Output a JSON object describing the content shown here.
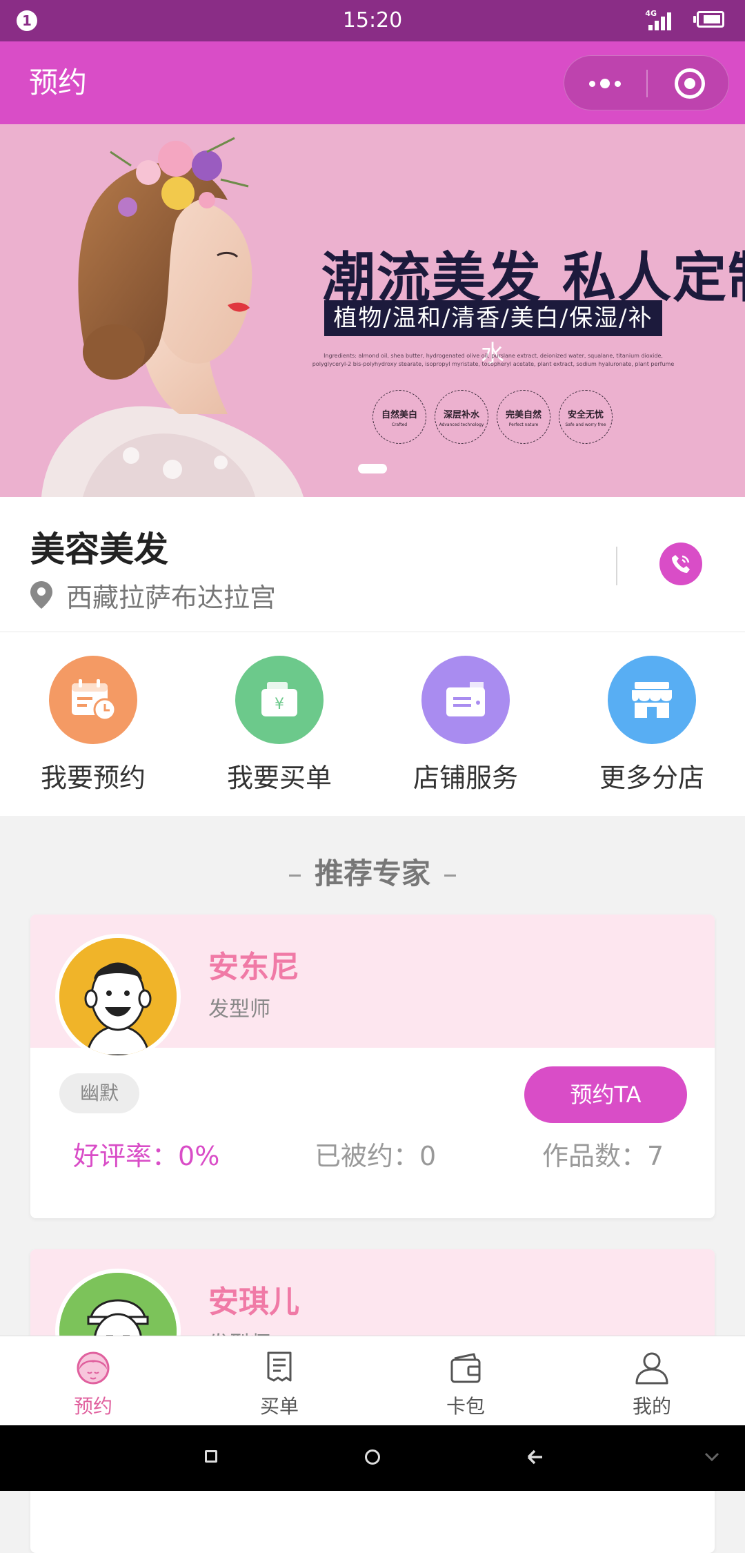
{
  "status_bar": {
    "time": "15:20",
    "notification": "1",
    "network": "4G"
  },
  "header": {
    "title": "预约"
  },
  "banner": {
    "headline": "潮流美发 私人定制",
    "subline": "植物/温和/清香/美白/保湿/补水",
    "fine_print": "Ingredients: almond oil, shea butter, hydrogenated olive oil, purslane extract, deionized water, squalane, titanium dioxide, polyglyceryl-2 bis-polyhydroxy stearate, isopropyl myristate, tocopheryl acetate, plant extract, sodium hyaluronate, plant perfume",
    "badges": [
      {
        "title": "自然美白",
        "sub": "Crafted"
      },
      {
        "title": "深层补水",
        "sub": "Advanced technology"
      },
      {
        "title": "完美自然",
        "sub": "Perfect nature"
      },
      {
        "title": "安全无忧",
        "sub": "Safe and worry free"
      }
    ]
  },
  "shop": {
    "name": "美容美发",
    "address": "西藏拉萨布达拉宫"
  },
  "quick_actions": [
    {
      "label": "我要预约",
      "icon": "calendar-clock-icon",
      "color": "#f49a64"
    },
    {
      "label": "我要买单",
      "icon": "wallet-yen-icon",
      "color": "#6cc98b"
    },
    {
      "label": "店铺服务",
      "icon": "card-folder-icon",
      "color": "#a98cf0"
    },
    {
      "label": "更多分店",
      "icon": "storefront-icon",
      "color": "#58aef3"
    }
  ],
  "section_title": "推荐专家",
  "experts": [
    {
      "name": "安东尼",
      "role": "发型师",
      "tag": "幽默",
      "book_label": "预约TA",
      "rating_label": "好评率：",
      "rating": "0%",
      "booked_label": "已被约：",
      "booked": "0",
      "works_label": "作品数：",
      "works": "7"
    },
    {
      "name": "安琪儿",
      "role": "发型师"
    }
  ],
  "tabbar": {
    "items": [
      {
        "label": "预约",
        "icon": "girl-face-icon",
        "active": true
      },
      {
        "label": "买单",
        "icon": "receipt-icon",
        "active": false
      },
      {
        "label": "卡包",
        "icon": "card-wallet-icon",
        "active": false
      },
      {
        "label": "我的",
        "icon": "person-icon",
        "active": false
      }
    ]
  },
  "colors": {
    "status_bar": "#8a2d86",
    "header": "#d94dc7",
    "accent": "#d94dc7",
    "expert_name": "#f07aa6",
    "card_header": "#fde6ef",
    "active_tab": "#e0609e"
  }
}
